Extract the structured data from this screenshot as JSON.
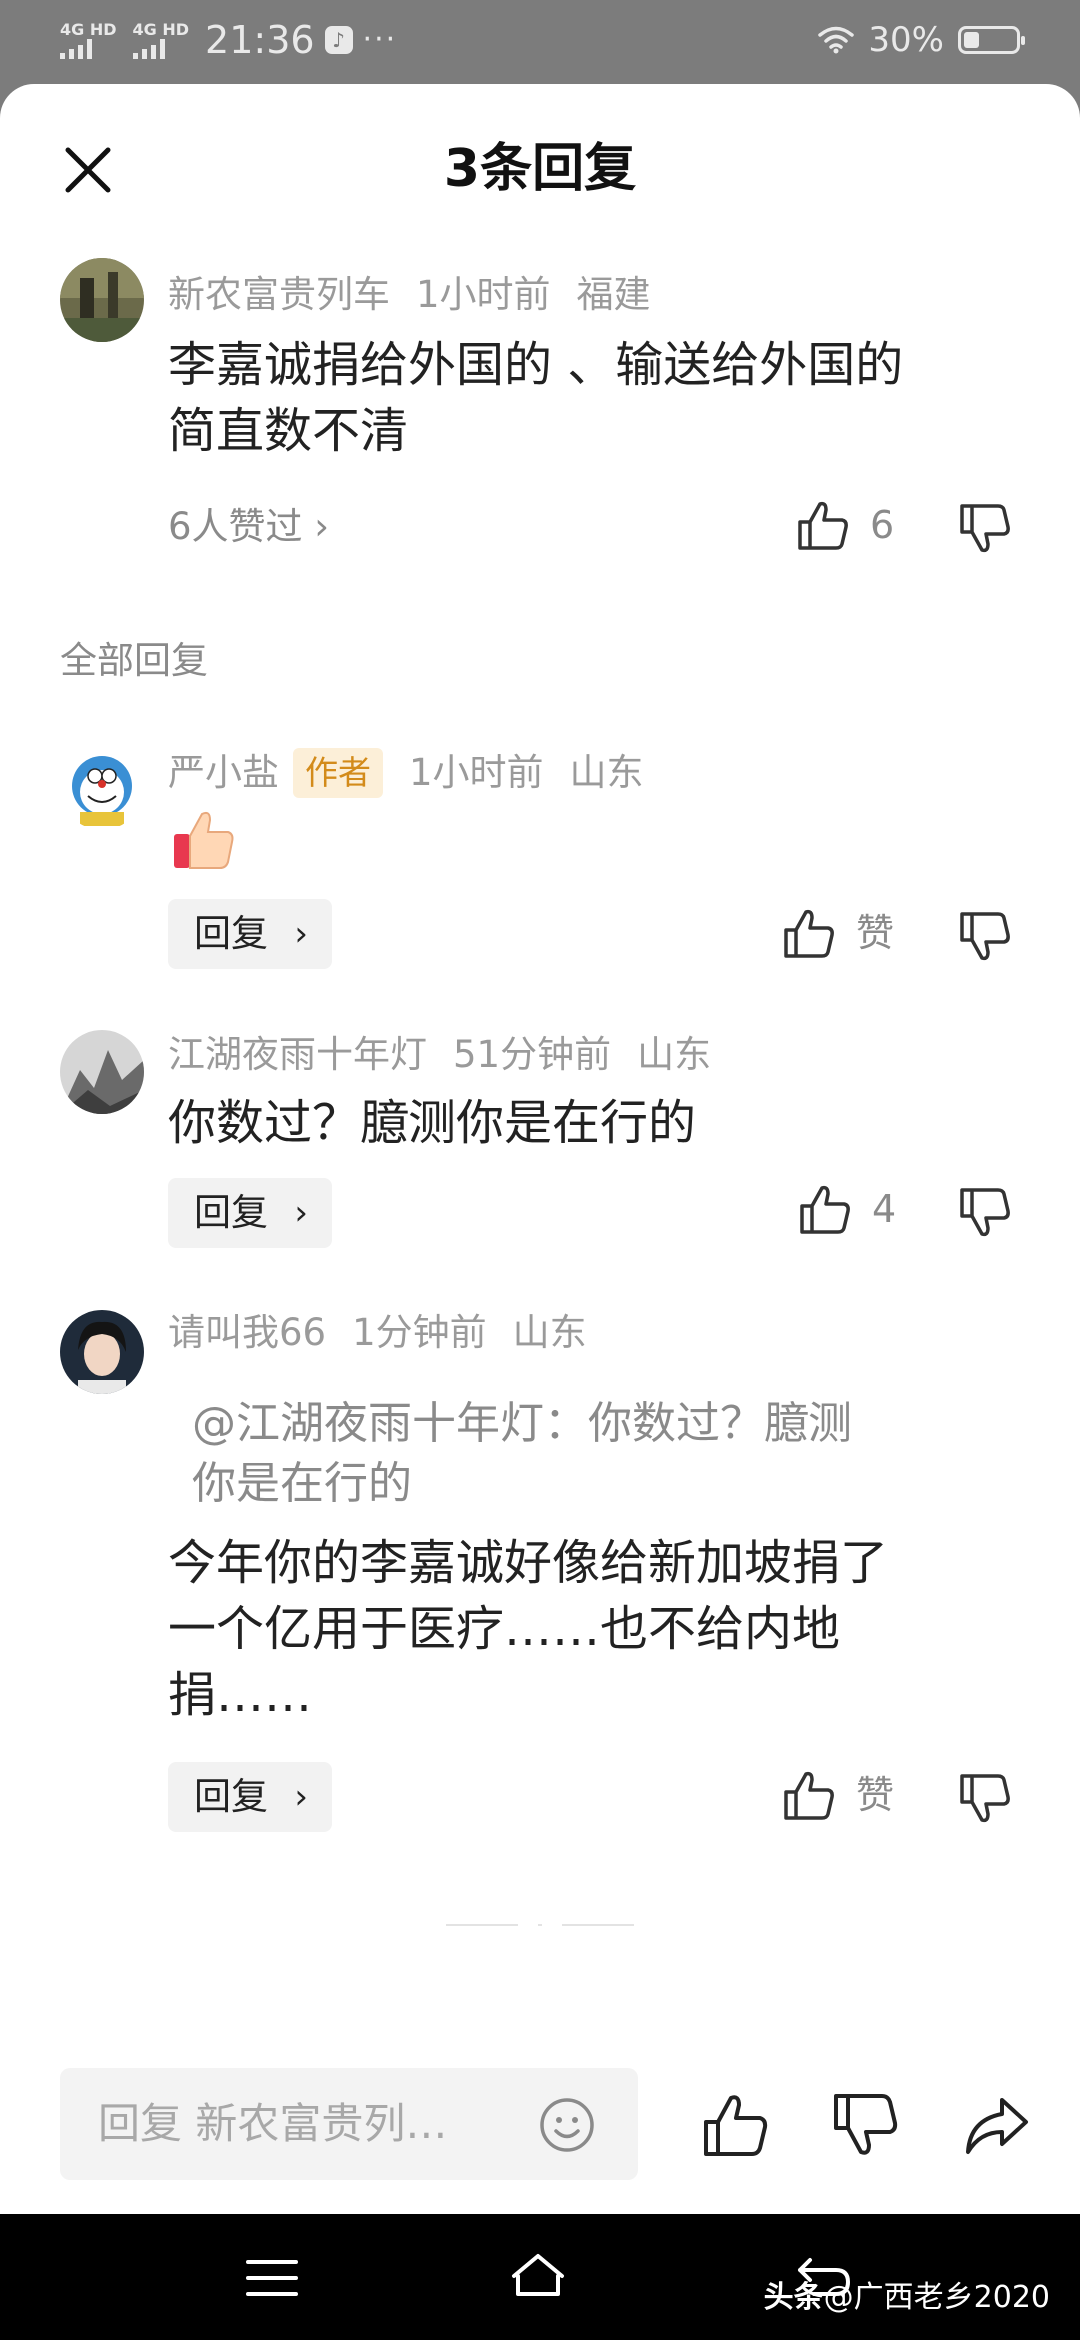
{
  "status_bar": {
    "signal1": "4G HD",
    "signal2": "4G HD",
    "time": "21:36",
    "dots": "···",
    "battery_text": "30%",
    "battery_level": 0.3
  },
  "sheet": {
    "title": "3条回复"
  },
  "top_comment": {
    "user": "新农富贵列车",
    "time": "1小时前",
    "location": "福建",
    "text_line1": "李嘉诚捐给外国的 、输送给外国的",
    "text_line2": "简直数不清",
    "likers": "6人赞过",
    "like_count": "6"
  },
  "section_label": "全部回复",
  "replies": [
    {
      "user": "严小盐",
      "badge": "作者",
      "time": "1小时前",
      "location": "山东",
      "reply_label": "回复",
      "like_label": "赞"
    },
    {
      "user": "江湖夜雨十年灯",
      "time": "51分钟前",
      "location": "山东",
      "text": "你数过？臆测你是在行的",
      "reply_label": "回复",
      "like_count": "4"
    },
    {
      "user": "请叫我66",
      "time": "1分钟前",
      "location": "山东",
      "quote_line1": "@江湖夜雨十年灯：你数过？臆测",
      "quote_line2": "你是在行的",
      "text_line1": "今年你的李嘉诚好像给新加坡捐了",
      "text_line2": "一个亿用于医疗……也不给内地",
      "text_line3": "捐……",
      "reply_label": "回复",
      "like_label": "赞"
    }
  ],
  "input_bar": {
    "placeholder": "回复 新农富贵列…"
  },
  "watermark": {
    "brand": "头条",
    "handle": "@广西老乡2020"
  },
  "colors": {
    "muted": "#9a9a9a",
    "badge_bg": "#fcefd8",
    "badge_fg": "#d38b1a"
  }
}
